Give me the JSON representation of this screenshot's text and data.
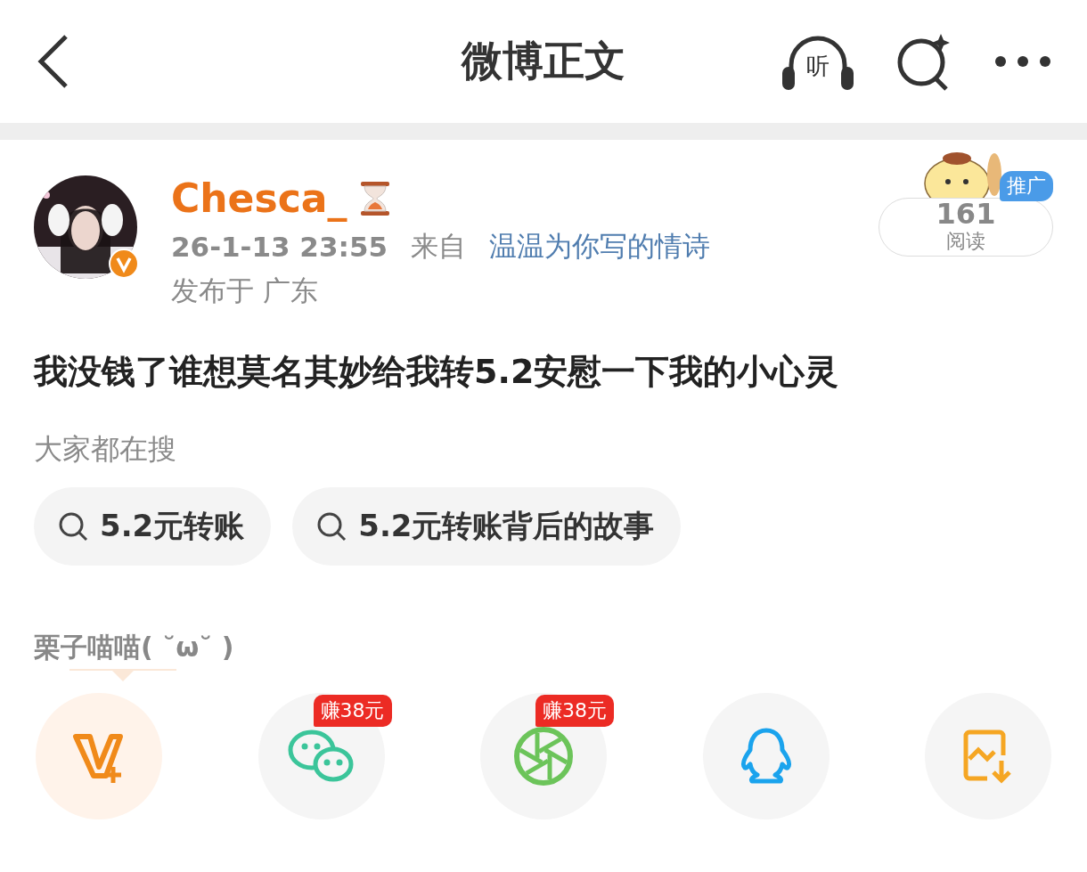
{
  "header": {
    "title": "微博正文",
    "listen_label": "听"
  },
  "post": {
    "author": "Chesca_",
    "time": "26-1-13 23:55",
    "source_prefix": "来自",
    "source": "温温为你写的情诗",
    "location": "发布于 广东",
    "text": "我没钱了谁想莫名其妙给我转5.2安慰一下我的小心灵",
    "reads": "161",
    "reads_label": "阅读",
    "promo": "推广"
  },
  "hot_search": {
    "title": "大家都在搜",
    "chips": [
      "5.2元转账",
      "5.2元转账背后的故事"
    ]
  },
  "share": {
    "user": "栗子喵喵( ˘ω˘ )",
    "targets": [
      {
        "kind": "vplus"
      },
      {
        "kind": "wechat",
        "badge": "赚38元"
      },
      {
        "kind": "moments",
        "badge": "赚38元"
      },
      {
        "kind": "qq"
      },
      {
        "kind": "save"
      }
    ]
  }
}
